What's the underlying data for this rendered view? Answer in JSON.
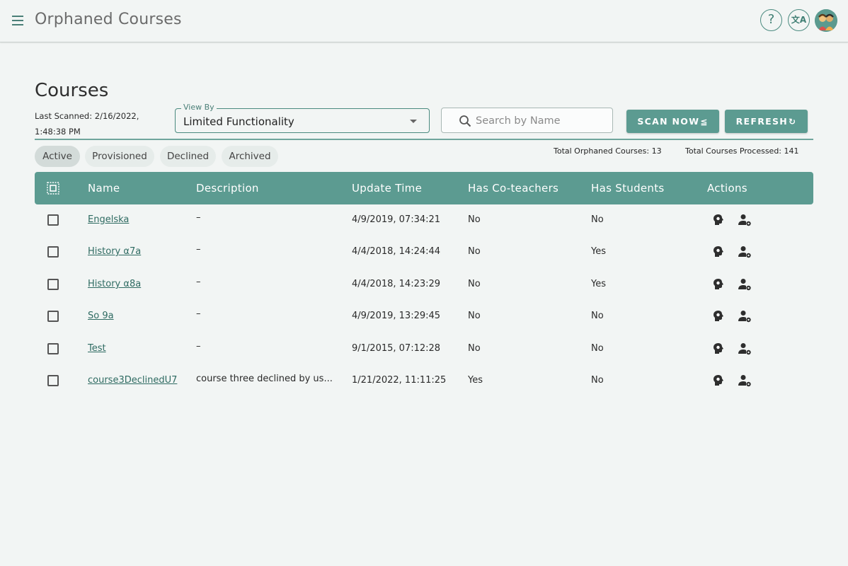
{
  "appbar": {
    "title": "Orphaned Courses",
    "help_icon": "?",
    "translate_icon": "文A"
  },
  "page": {
    "title": "Courses",
    "last_scanned": "Last Scanned: 2/16/2022, 1:48:38 PM"
  },
  "view_by": {
    "label": "View By",
    "value": "Limited Functionality"
  },
  "search": {
    "placeholder": "Search by Name"
  },
  "buttons": {
    "scan_now": "SCAN NOW",
    "refresh": "REFRESH"
  },
  "filters": {
    "chips": [
      {
        "label": "Active",
        "active": true
      },
      {
        "label": "Provisioned",
        "active": false
      },
      {
        "label": "Declined",
        "active": false
      },
      {
        "label": "Archived",
        "active": false
      }
    ]
  },
  "totals": {
    "orphaned": "Total Orphaned Courses: 13",
    "processed": "Total Courses Processed: 141"
  },
  "table": {
    "headers": {
      "name": "Name",
      "description": "Description",
      "update_time": "Update Time",
      "has_coteachers": "Has Co-teachers",
      "has_students": "Has Students",
      "actions": "Actions"
    },
    "rows": [
      {
        "name": "Engelska",
        "description": "–",
        "update_time": "4/9/2019, 07:34:21",
        "has_coteachers": "No",
        "has_students": "No"
      },
      {
        "name": "History α7a",
        "description": "–",
        "update_time": "4/4/2018, 14:24:44",
        "has_coteachers": "No",
        "has_students": "Yes"
      },
      {
        "name": "History α8a",
        "description": "–",
        "update_time": "4/4/2018, 14:23:29",
        "has_coteachers": "No",
        "has_students": "Yes"
      },
      {
        "name": "So 9a",
        "description": "–",
        "update_time": "4/9/2019, 13:29:45",
        "has_coteachers": "No",
        "has_students": "No"
      },
      {
        "name": "Test",
        "description": "–",
        "update_time": "9/1/2015, 07:12:28",
        "has_coteachers": "No",
        "has_students": "No"
      },
      {
        "name": "course3DeclinedU7",
        "description": "course three declined by us...",
        "update_time": "1/21/2022, 11:11:25",
        "has_coteachers": "Yes",
        "has_students": "No"
      }
    ]
  },
  "colors": {
    "accent": "#5c9b91",
    "background": "#f2f5f4",
    "link": "#2f6b62"
  }
}
